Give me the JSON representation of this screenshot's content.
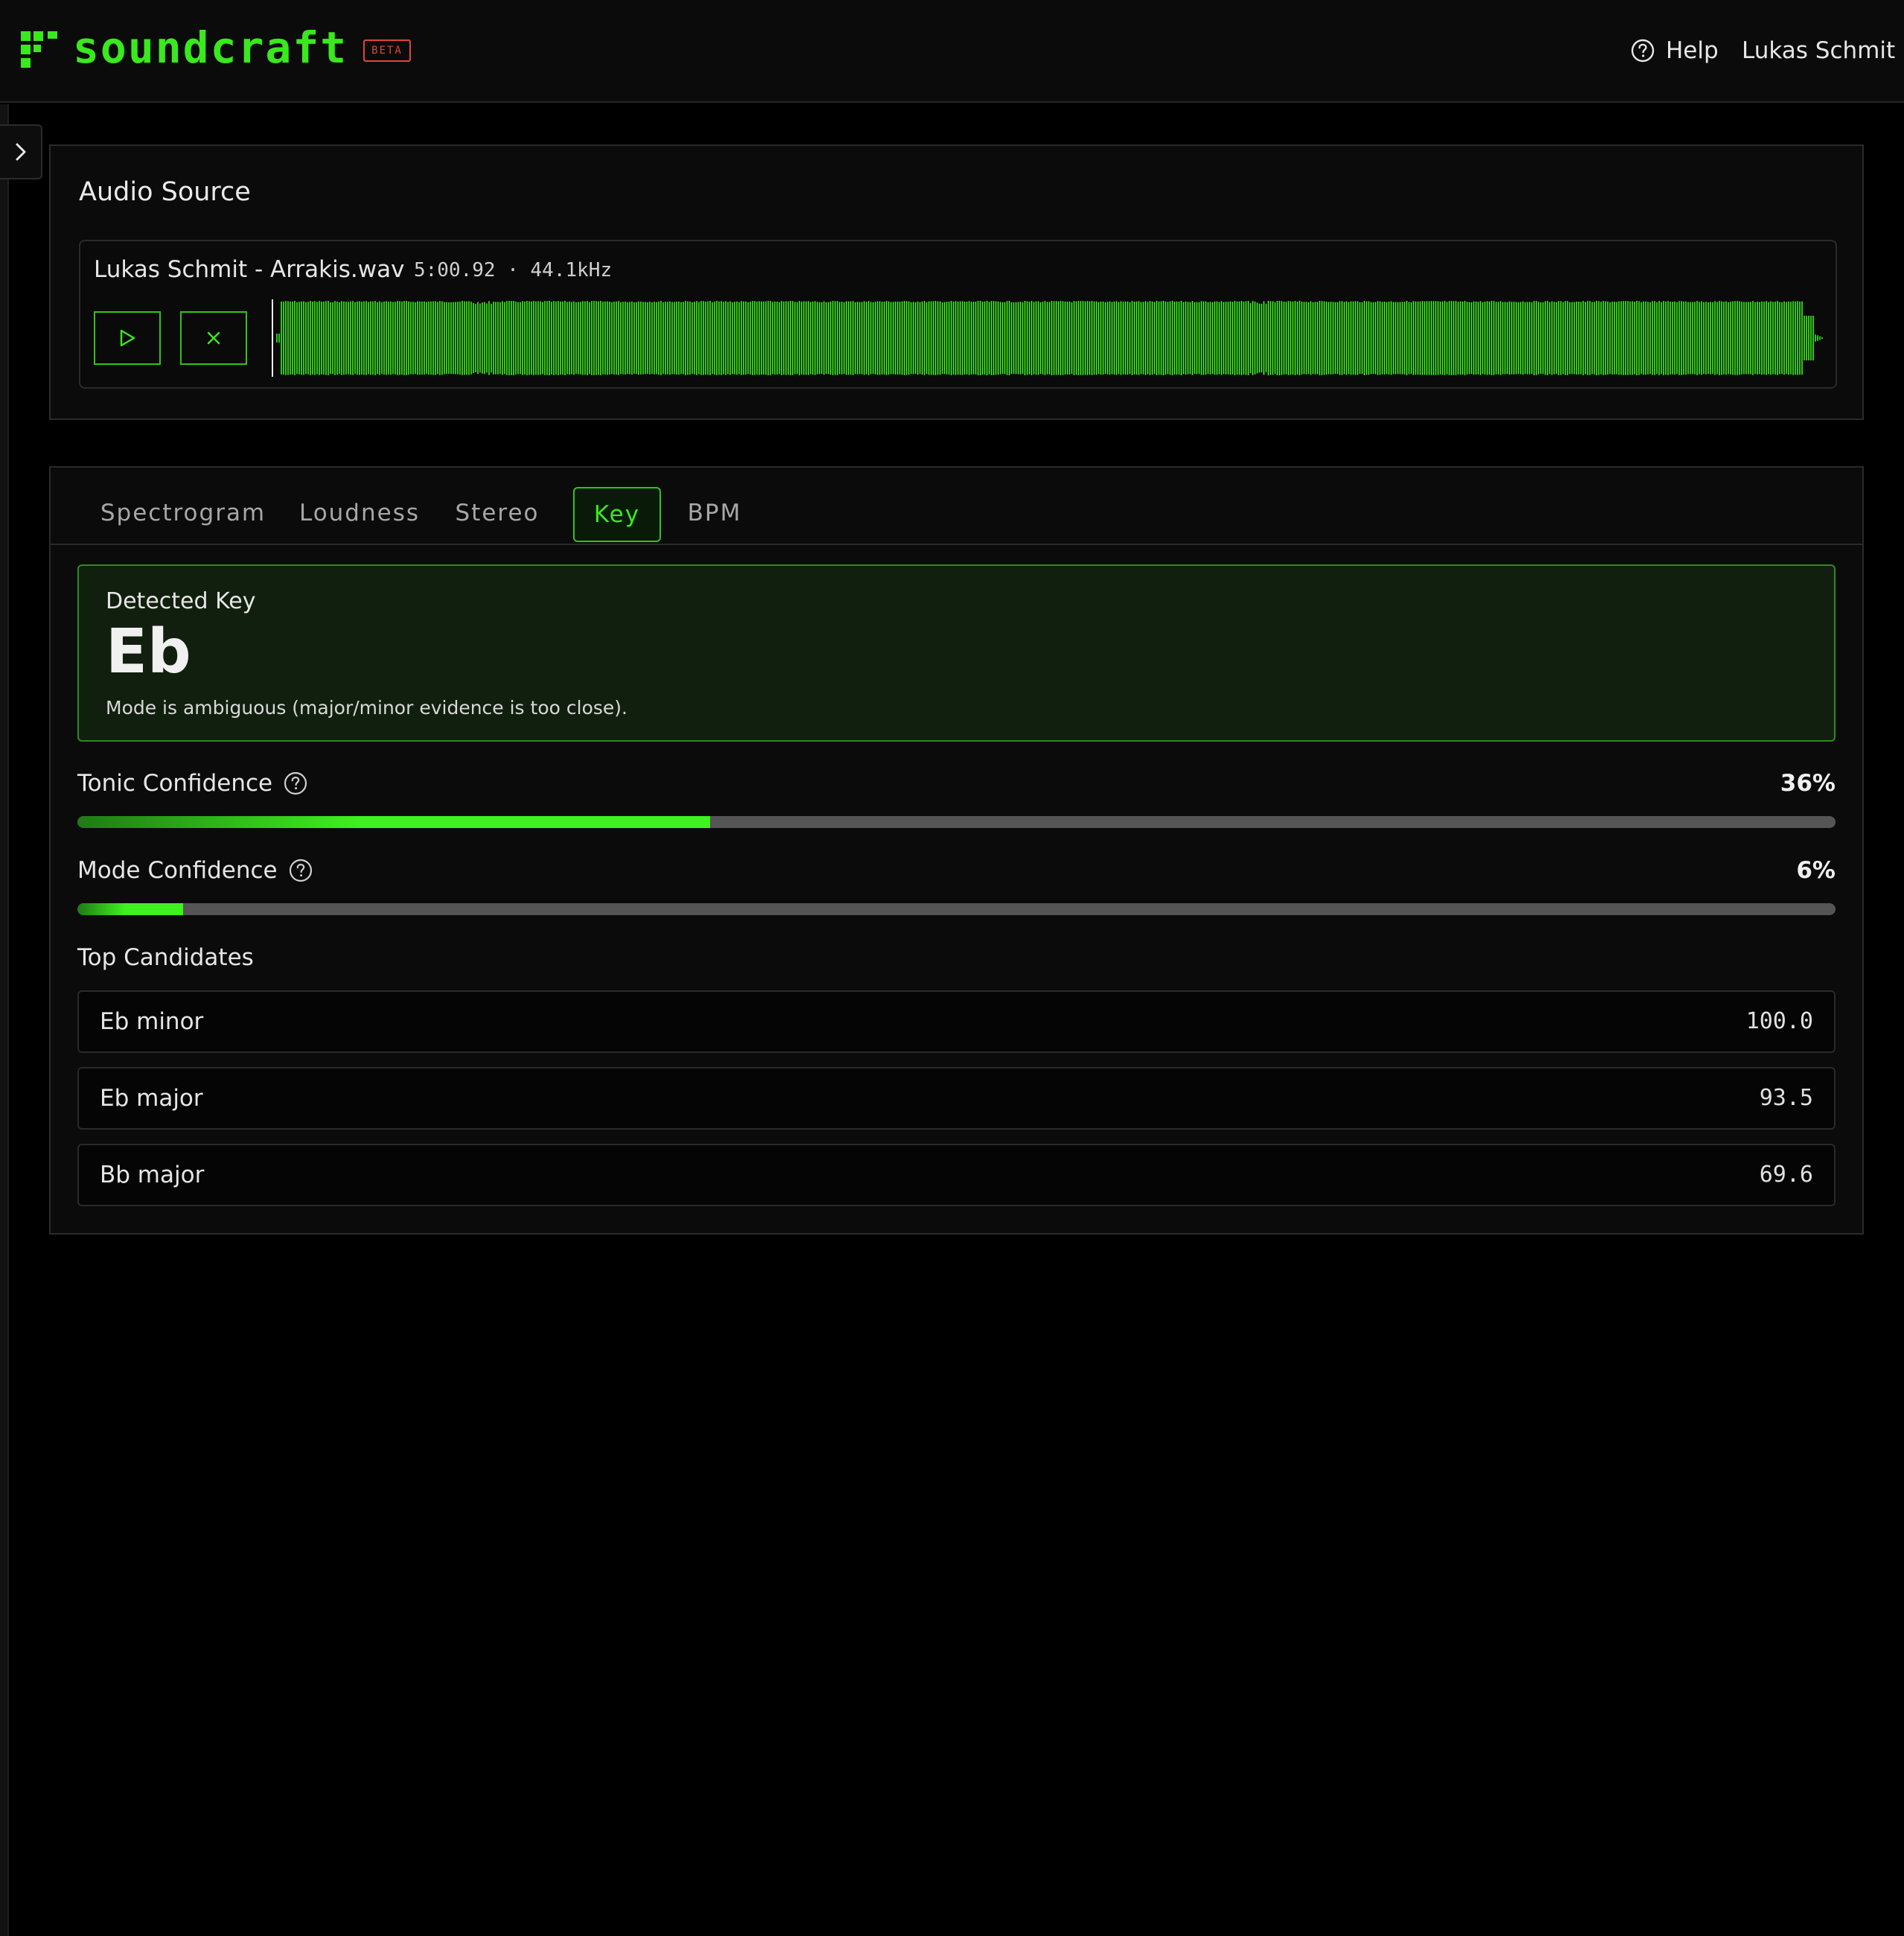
{
  "brand": {
    "name": "soundcraft",
    "badge": "BETA",
    "accent": "#39e91d"
  },
  "header": {
    "help_label": "Help",
    "user_name": "Lukas Schmit"
  },
  "audio_source": {
    "title": "Audio Source",
    "file_name": "Lukas Schmit - Arrakis.wav",
    "meta": "5:00.92 · 44.1kHz",
    "play_icon": "play-icon",
    "close_icon": "close-icon"
  },
  "tabs": [
    {
      "label": "Spectrogram",
      "active": false
    },
    {
      "label": "Loudness",
      "active": false
    },
    {
      "label": "Stereo",
      "active": false
    },
    {
      "label": "Key",
      "active": true
    },
    {
      "label": "BPM",
      "active": false
    }
  ],
  "key": {
    "detected_label": "Detected Key",
    "detected_value": "Eb",
    "note": "Mode is ambiguous (major/minor evidence is too close)."
  },
  "tonic": {
    "label": "Tonic Confidence",
    "value": "36%",
    "fraction": 0.36
  },
  "mode": {
    "label": "Mode Confidence",
    "value": "6%",
    "fraction": 0.06
  },
  "candidates": {
    "title": "Top Candidates",
    "items": [
      {
        "name": "Eb minor",
        "score": "100.0"
      },
      {
        "name": "Eb major",
        "score": "93.5"
      },
      {
        "name": "Bb major",
        "score": "69.6"
      }
    ]
  }
}
